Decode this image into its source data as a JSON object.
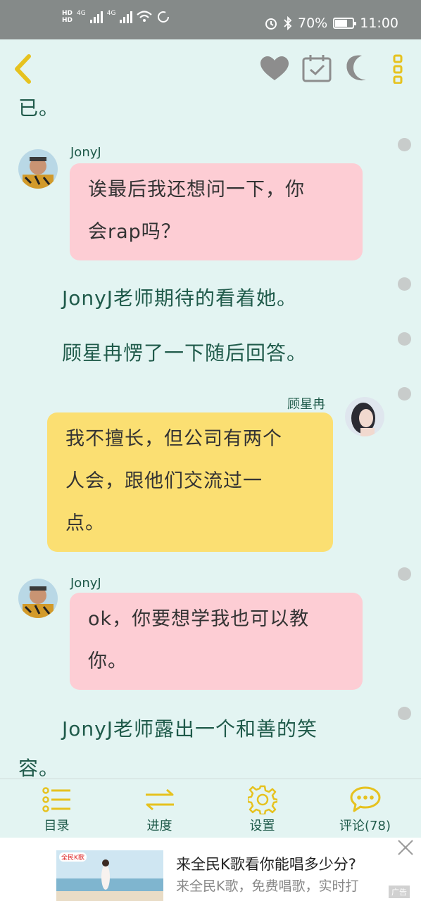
{
  "status_bar": {
    "hd1": "HD",
    "hd2": "HD",
    "net1": "4G",
    "net2": "4G",
    "battery_pct": "70%",
    "battery_level": 0.7,
    "time": "11:00"
  },
  "toolbar": {
    "back_icon": "chevron-left-icon",
    "favorite_icon": "heart-icon",
    "calendar_icon": "calendar-check-icon",
    "night_icon": "moon-icon",
    "more_icon": "more-vertical-icon"
  },
  "content": {
    "top_fragment": "已。",
    "messages": [
      {
        "type": "bubble",
        "name": "JonyJ",
        "text": "诶最后我还想问一下，你\n会rap吗？"
      },
      {
        "type": "narration",
        "text": "JonyJ老师期待的看着她。"
      },
      {
        "type": "narration",
        "text": "顾星冉愣了一下随后回答。"
      },
      {
        "type": "bubble",
        "name": "顾星冉",
        "text": "我不擅长，但公司有两个\n人会，跟他们交流过一\n点。"
      },
      {
        "type": "bubble",
        "name": "JonyJ",
        "text": "ok，你要想学我也可以教\n你。"
      },
      {
        "type": "narration",
        "text": "JonyJ老师露出一个和善的笑\n容。"
      }
    ]
  },
  "bottom_nav": {
    "items": [
      {
        "label": "目录",
        "icon": "list-icon"
      },
      {
        "label": "进度",
        "icon": "swap-arrows-icon"
      },
      {
        "label": "设置",
        "icon": "gear-icon"
      },
      {
        "label": "评论(78)",
        "icon": "comment-icon"
      }
    ]
  },
  "ad": {
    "brand": "全民K歌",
    "title": "来全民K歌看你能唱多少分?",
    "subtitle": "来全民K歌，免费唱歌，实时打",
    "tag": "广告",
    "close_icon": "close-icon"
  },
  "colors": {
    "background": "#e3f4f2",
    "text": "#1f5a4a",
    "bubble_left": "#fdcdd4",
    "bubble_right": "#fbdf72",
    "accent": "#e6c21f"
  }
}
